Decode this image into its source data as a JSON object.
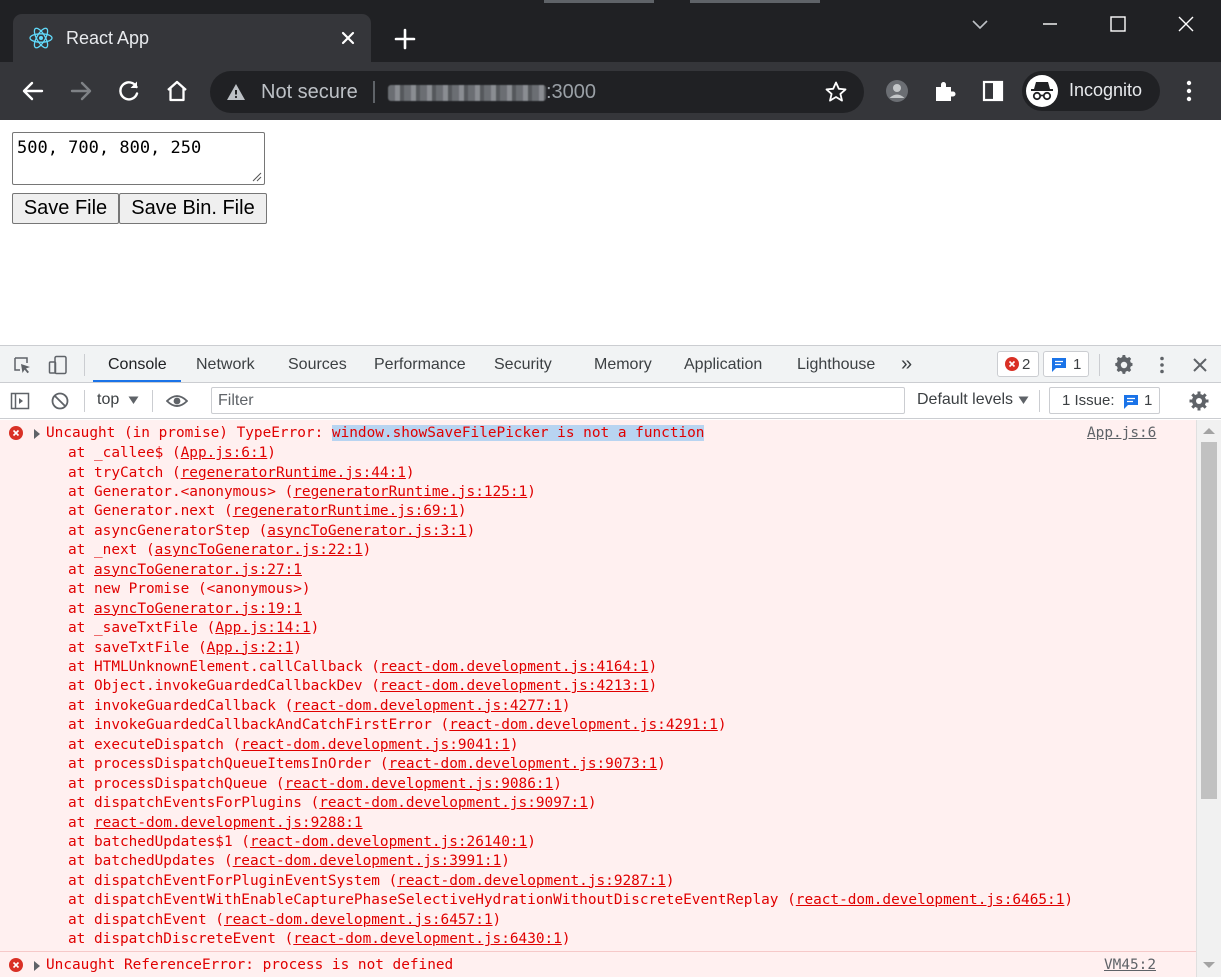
{
  "browser": {
    "tab_title": "React App",
    "incognito_label": "Incognito",
    "omnibox": {
      "security_label": "Not secure",
      "port": ":3000"
    }
  },
  "page": {
    "textarea_value": "500, 700, 800, 250",
    "save_file_label": "Save File",
    "save_bin_label": "Save Bin. File"
  },
  "devtools": {
    "tabs": [
      "Console",
      "Network",
      "Sources",
      "Performance",
      "Security",
      "Memory",
      "Application",
      "Lighthouse"
    ],
    "active_tab": "Console",
    "more_tabs_glyph": "»",
    "error_count": "2",
    "message_count": "1",
    "context": "top",
    "filter_placeholder": "Filter",
    "levels_label": "Default levels",
    "issues_label": "1 Issue:",
    "issues_count": "1"
  },
  "console": {
    "error1": {
      "prefix": "Uncaught (in promise) TypeError: ",
      "highlight": "window.showSaveFilePicker is not a function",
      "source": "App.js:6",
      "frames": [
        {
          "fn": "at _callee$ (",
          "loc": "App.js:6:1",
          "end": ")"
        },
        {
          "fn": "at tryCatch (",
          "loc": "regeneratorRuntime.js:44:1",
          "end": ")"
        },
        {
          "fn": "at Generator.<anonymous> (",
          "loc": "regeneratorRuntime.js:125:1",
          "end": ")"
        },
        {
          "fn": "at Generator.next (",
          "loc": "regeneratorRuntime.js:69:1",
          "end": ")"
        },
        {
          "fn": "at asyncGeneratorStep (",
          "loc": "asyncToGenerator.js:3:1",
          "end": ")"
        },
        {
          "fn": "at _next (",
          "loc": "asyncToGenerator.js:22:1",
          "end": ")"
        },
        {
          "fn": "at ",
          "loc": "asyncToGenerator.js:27:1",
          "end": ""
        },
        {
          "fn": "at new Promise (<anonymous>)",
          "loc": "",
          "end": ""
        },
        {
          "fn": "at ",
          "loc": "asyncToGenerator.js:19:1",
          "end": ""
        },
        {
          "fn": "at _saveTxtFile (",
          "loc": "App.js:14:1",
          "end": ")"
        },
        {
          "fn": "at saveTxtFile (",
          "loc": "App.js:2:1",
          "end": ")"
        },
        {
          "fn": "at HTMLUnknownElement.callCallback (",
          "loc": "react-dom.development.js:4164:1",
          "end": ")"
        },
        {
          "fn": "at Object.invokeGuardedCallbackDev (",
          "loc": "react-dom.development.js:4213:1",
          "end": ")"
        },
        {
          "fn": "at invokeGuardedCallback (",
          "loc": "react-dom.development.js:4277:1",
          "end": ")"
        },
        {
          "fn": "at invokeGuardedCallbackAndCatchFirstError (",
          "loc": "react-dom.development.js:4291:1",
          "end": ")"
        },
        {
          "fn": "at executeDispatch (",
          "loc": "react-dom.development.js:9041:1",
          "end": ")"
        },
        {
          "fn": "at processDispatchQueueItemsInOrder (",
          "loc": "react-dom.development.js:9073:1",
          "end": ")"
        },
        {
          "fn": "at processDispatchQueue (",
          "loc": "react-dom.development.js:9086:1",
          "end": ")"
        },
        {
          "fn": "at dispatchEventsForPlugins (",
          "loc": "react-dom.development.js:9097:1",
          "end": ")"
        },
        {
          "fn": "at ",
          "loc": "react-dom.development.js:9288:1",
          "end": ""
        },
        {
          "fn": "at batchedUpdates$1 (",
          "loc": "react-dom.development.js:26140:1",
          "end": ")"
        },
        {
          "fn": "at batchedUpdates (",
          "loc": "react-dom.development.js:3991:1",
          "end": ")"
        },
        {
          "fn": "at dispatchEventForPluginEventSystem (",
          "loc": "react-dom.development.js:9287:1",
          "end": ")"
        },
        {
          "fn": "at dispatchEventWithEnableCapturePhaseSelectiveHydrationWithoutDiscreteEventReplay (",
          "loc": "react-dom.development.js:6465:1",
          "end": ")"
        },
        {
          "fn": "at dispatchEvent (",
          "loc": "react-dom.development.js:6457:1",
          "end": ")"
        },
        {
          "fn": "at dispatchDiscreteEvent (",
          "loc": "react-dom.development.js:6430:1",
          "end": ")"
        }
      ]
    },
    "error2": {
      "text": "Uncaught ReferenceError: process is not defined",
      "source": "VM45:2"
    }
  },
  "colors": {
    "chrome_dark": "#202124",
    "toolbar": "#35363a",
    "console_error_bg": "#fff0f0",
    "console_error_text": "#e00000",
    "accent_blue": "#1a73e8",
    "selection": "#b8d4f1"
  },
  "icons": {
    "tab_favicon": "react-logo-icon",
    "tab_close": "close-icon",
    "new_tab": "plus-icon",
    "tab_search": "chevron-down-icon",
    "minimize": "minimize-icon",
    "maximize": "maximize-icon",
    "close_window": "close-window-icon",
    "back": "arrow-left-icon",
    "forward": "arrow-right-icon",
    "reload": "reload-icon",
    "home": "home-icon",
    "warning": "warning-icon",
    "bookmark": "star-icon",
    "extension_avatar": "extension-icon",
    "extensions": "puzzle-icon",
    "side_panel": "side-panel-icon",
    "incognito": "incognito-icon",
    "menu": "kebab-menu-icon"
  }
}
